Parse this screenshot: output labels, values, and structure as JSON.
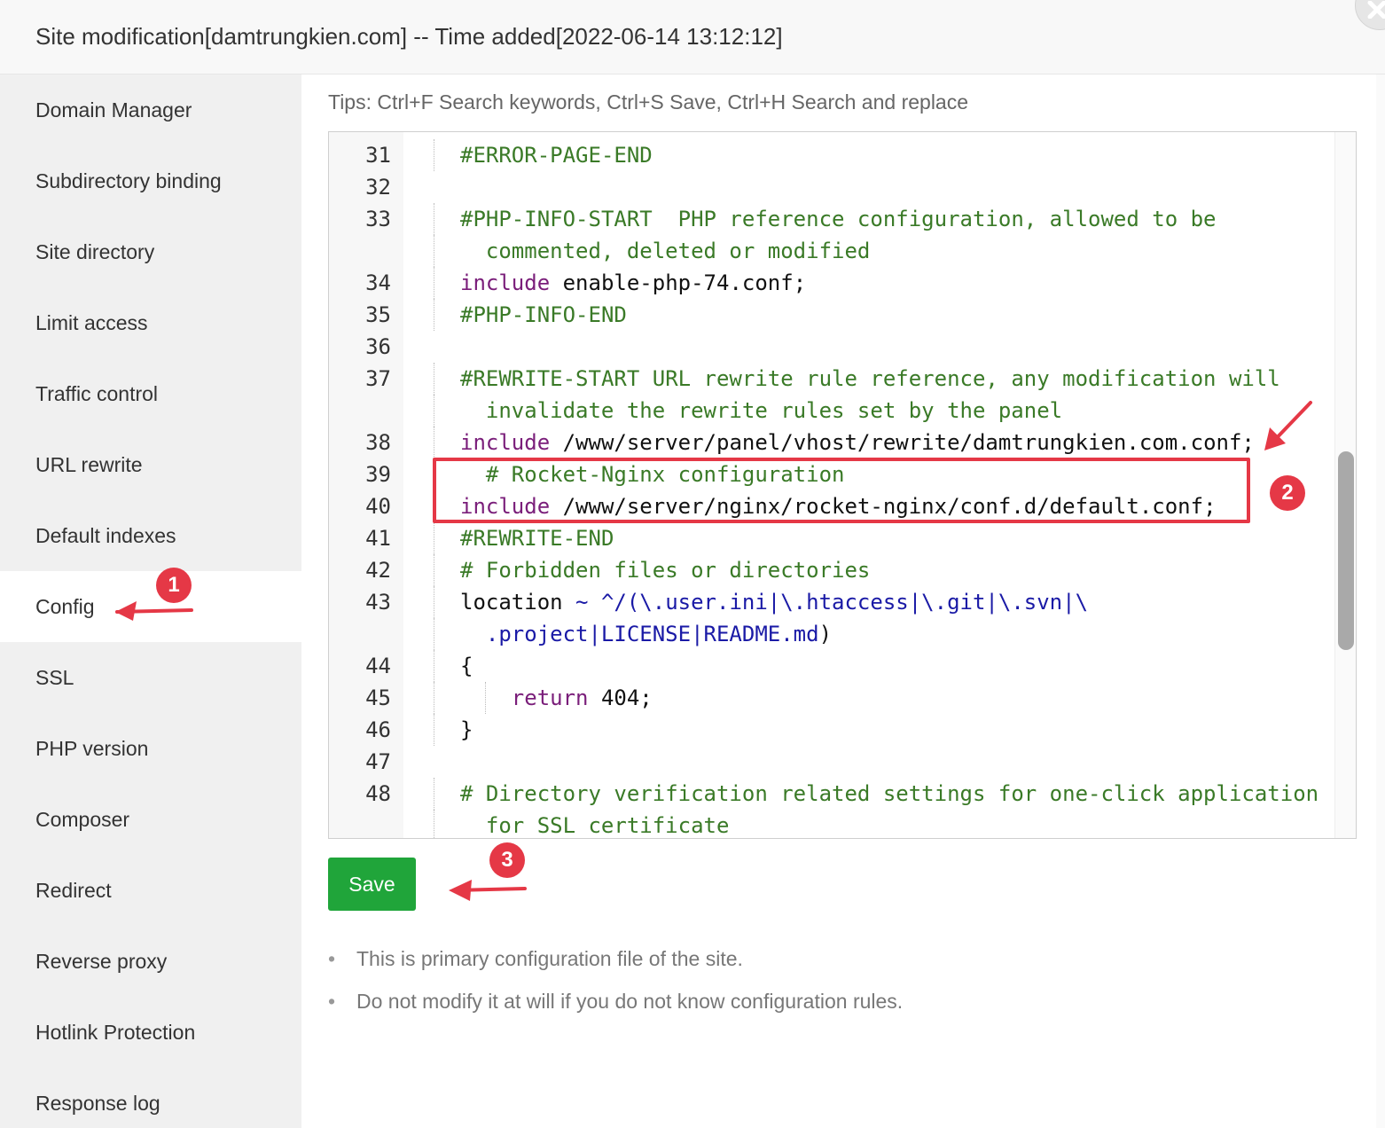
{
  "header": {
    "title": "Site modification[damtrungkien.com] -- Time added[2022-06-14 13:12:12]"
  },
  "sidebar": {
    "items": [
      {
        "label": "Domain Manager"
      },
      {
        "label": "Subdirectory binding"
      },
      {
        "label": "Site directory"
      },
      {
        "label": "Limit access"
      },
      {
        "label": "Traffic control"
      },
      {
        "label": "URL rewrite"
      },
      {
        "label": "Default indexes"
      },
      {
        "label": "Config",
        "active": true
      },
      {
        "label": "SSL"
      },
      {
        "label": "PHP version"
      },
      {
        "label": "Composer"
      },
      {
        "label": "Redirect"
      },
      {
        "label": "Reverse proxy"
      },
      {
        "label": "Hotlink Protection"
      },
      {
        "label": "Response log"
      }
    ]
  },
  "tips": "Tips:  Ctrl+F Search keywords,  Ctrl+S Save,  Ctrl+H Search and replace",
  "editor": {
    "lines": [
      {
        "n": "31",
        "segs": [
          [
            "comment",
            "#ERROR-PAGE-END"
          ]
        ]
      },
      {
        "n": "32",
        "segs": []
      },
      {
        "n": "33",
        "segs": [
          [
            "comment",
            "#PHP-INFO-START  PHP reference configuration, allowed to be"
          ]
        ]
      },
      {
        "n": "",
        "segs": [
          [
            "comment",
            "commented, deleted or modified"
          ]
        ]
      },
      {
        "n": "34",
        "segs": [
          [
            "kw",
            "include"
          ],
          [
            "plain",
            " enable-php-74.conf;"
          ]
        ]
      },
      {
        "n": "35",
        "segs": [
          [
            "comment",
            "#PHP-INFO-END"
          ]
        ]
      },
      {
        "n": "36",
        "segs": []
      },
      {
        "n": "37",
        "segs": [
          [
            "comment",
            "#REWRITE-START URL rewrite rule reference, any modification will"
          ]
        ]
      },
      {
        "n": "",
        "segs": [
          [
            "comment",
            "invalidate the rewrite rules set by the panel"
          ]
        ]
      },
      {
        "n": "38",
        "segs": [
          [
            "kw",
            "include"
          ],
          [
            "plain",
            " /www/server/panel/vhost/rewrite/damtrungkien.com.conf;"
          ]
        ]
      },
      {
        "n": "39",
        "segs": [
          [
            "comment",
            "# Rocket-Nginx configuration"
          ]
        ]
      },
      {
        "n": "40",
        "segs": [
          [
            "kw",
            "include"
          ],
          [
            "plain",
            " /www/server/nginx/rocket-nginx/conf.d/default.conf;"
          ]
        ]
      },
      {
        "n": "41",
        "segs": [
          [
            "comment",
            "#REWRITE-END"
          ]
        ]
      },
      {
        "n": "42",
        "segs": [
          [
            "comment",
            "# Forbidden files or directories"
          ]
        ]
      },
      {
        "n": "43",
        "segs": [
          [
            "plain",
            "location "
          ],
          [
            "str",
            "~ ^/(\\.user.ini|\\.htaccess|\\.git|\\.svn|\\"
          ]
        ]
      },
      {
        "n": "",
        "segs": [
          [
            "str",
            ".project|LICENSE|README.md"
          ],
          [
            "plain",
            ")"
          ]
        ]
      },
      {
        "n": "44",
        "segs": [
          [
            "plain",
            "{"
          ]
        ]
      },
      {
        "n": "45",
        "segs": [
          [
            "kw",
            "return"
          ],
          [
            "plain",
            " 404;"
          ]
        ]
      },
      {
        "n": "46",
        "segs": [
          [
            "plain",
            "}"
          ]
        ]
      },
      {
        "n": "47",
        "segs": []
      },
      {
        "n": "48",
        "segs": [
          [
            "comment",
            "# Directory verification related settings for one-click application"
          ]
        ]
      },
      {
        "n": "",
        "segs": [
          [
            "comment",
            "for SSL certificate"
          ]
        ]
      }
    ]
  },
  "save_label": "Save",
  "notes": [
    "This is primary configuration file of the site.",
    "Do not modify it at will if you do not know configuration rules."
  ],
  "annotations": {
    "badge1": "1",
    "badge2": "2",
    "badge3": "3"
  },
  "colors": {
    "accent_green": "#20a53a",
    "annotation_red": "#e53846",
    "comment_green": "#3a7a27",
    "keyword_purple": "#7a1e7a"
  }
}
